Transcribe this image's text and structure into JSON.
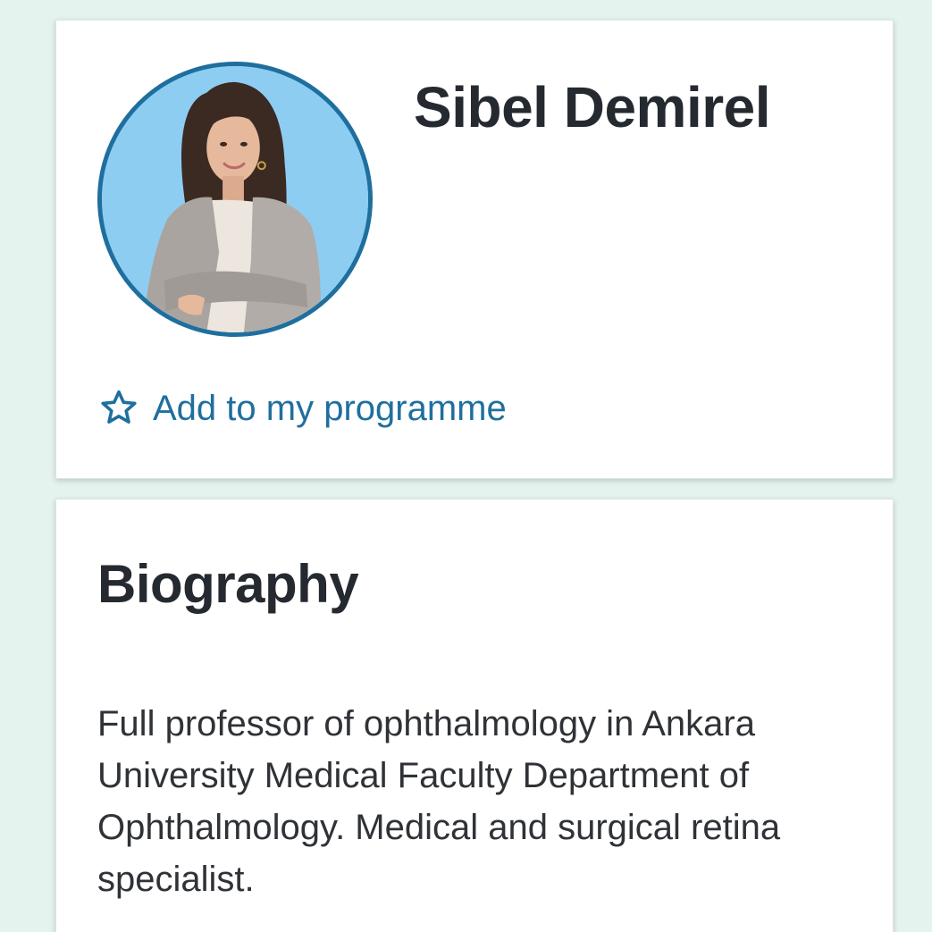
{
  "speaker": {
    "name": "Sibel Demirel",
    "photo_alt": "Sibel Demirel",
    "add_to_programme_label": "Add to my programme",
    "add_to_programme_icon": "star-outline-icon"
  },
  "biography": {
    "title": "Biography",
    "text": "Full professor of ophthalmology in Ankara University Medical Faculty Department of Ophthalmology. Medical and surgical retina specialist."
  },
  "colors": {
    "page_background": "#e5f3ee",
    "card_background": "#ffffff",
    "accent": "#1f6f9e",
    "heading_text": "#252a30",
    "body_text": "#2f3237",
    "avatar_background": "#8ecdf2"
  }
}
